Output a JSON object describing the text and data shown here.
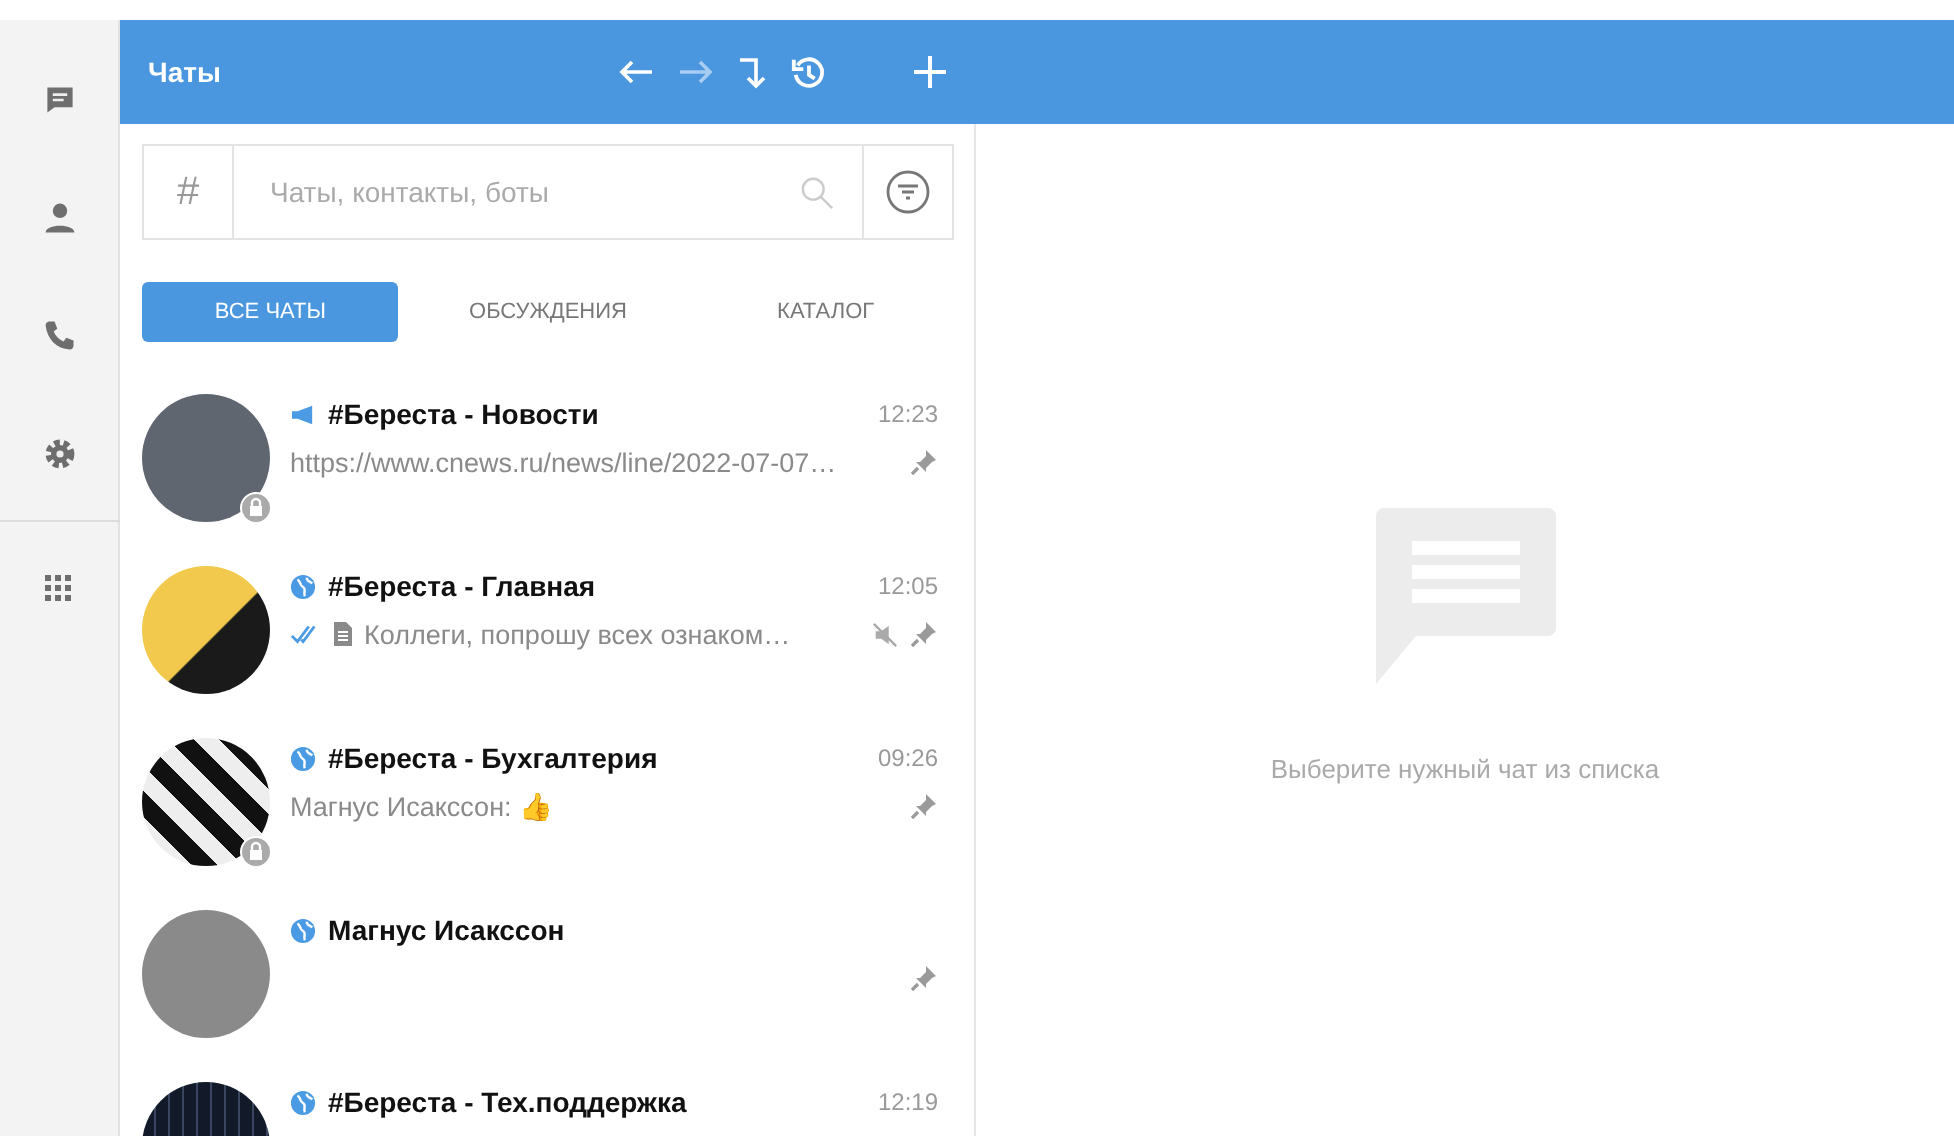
{
  "header": {
    "title": "Чаты"
  },
  "search": {
    "prefix": "#",
    "placeholder": "Чаты, контакты, боты"
  },
  "tabs": [
    {
      "label": "ВСЕ ЧАТЫ",
      "selected": true
    },
    {
      "label": "ОБСУЖДЕНИЯ",
      "selected": false
    },
    {
      "label": "КАТАЛОГ",
      "selected": false
    }
  ],
  "chats": [
    {
      "kind": "channel",
      "name": "#Береста - Новости",
      "time": "12:23",
      "preview": "https://www.cnews.ru/news/line/2022-07-07…",
      "read": false,
      "attachment": false,
      "muted": false,
      "pinned": true,
      "locked": true
    },
    {
      "kind": "public",
      "name": "#Береста - Главная",
      "time": "12:05",
      "preview": "Коллеги, попрошу всех ознаком…",
      "read": true,
      "attachment": true,
      "muted": true,
      "pinned": true,
      "locked": false
    },
    {
      "kind": "public",
      "name": "#Береста - Бухгалтерия",
      "time": "09:26",
      "preview": "Магнус Исакссон: 👍",
      "read": false,
      "attachment": false,
      "muted": false,
      "pinned": true,
      "locked": true
    },
    {
      "kind": "public",
      "name": "Магнус Исакссон",
      "read": false,
      "attachment": false,
      "muted": false,
      "pinned": true,
      "locked": false
    },
    {
      "kind": "public",
      "name": "#Береста - Тех.поддержка",
      "time": "12:19",
      "read": false,
      "attachment": false,
      "muted": false,
      "pinned": false,
      "locked": false
    }
  ],
  "empty_state": {
    "text": "Выберите нужный чат из списка"
  }
}
